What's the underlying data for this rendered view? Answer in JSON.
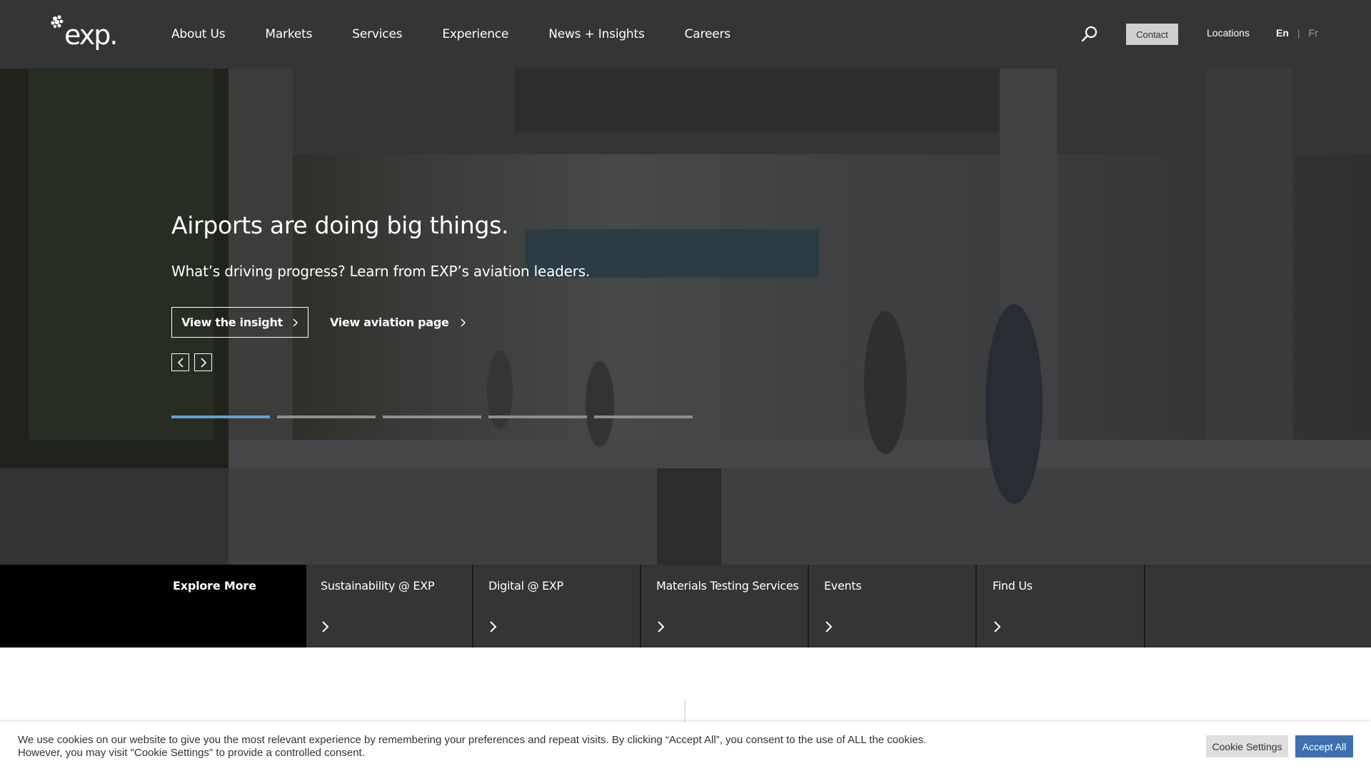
{
  "header": {
    "logo_text": "exp.",
    "nav": [
      "About Us",
      "Markets",
      "Services",
      "Experience",
      "News + Insights",
      "Careers"
    ],
    "search_icon": "search-icon",
    "contact_label": "Contact",
    "locations_label": "Locations",
    "lang_en": "En",
    "lang_sep": "|",
    "lang_fr": "Fr"
  },
  "hero": {
    "title": "Airports are doing big things.",
    "subtitle": "What’s driving progress? Learn from EXP’s aviation leaders.",
    "primary_button": "View the insight",
    "secondary_button": "View aviation page",
    "prev_icon": "chevron-left-icon",
    "next_icon": "chevron-right-icon",
    "slide_count": 5,
    "active_slide": 1,
    "active_color": "#6a9fd1"
  },
  "explore": {
    "label": "Explore More",
    "cards": [
      {
        "title": "Sustainability @ EXP"
      },
      {
        "title": "Digital @ EXP"
      },
      {
        "title": "Materials Testing Services"
      },
      {
        "title": "Events"
      },
      {
        "title": "Find Us"
      }
    ]
  },
  "cookie": {
    "text": "We use cookies on our website to give you the most relevant experience by remembering your preferences and repeat visits. By clicking “Accept All”, you consent to the use of ALL the cookies. However, you may visit \"Cookie Settings\" to provide a controlled consent.",
    "settings_label": "Cookie Settings",
    "accept_label": "Accept All",
    "accept_color": "#3e6fb0"
  }
}
